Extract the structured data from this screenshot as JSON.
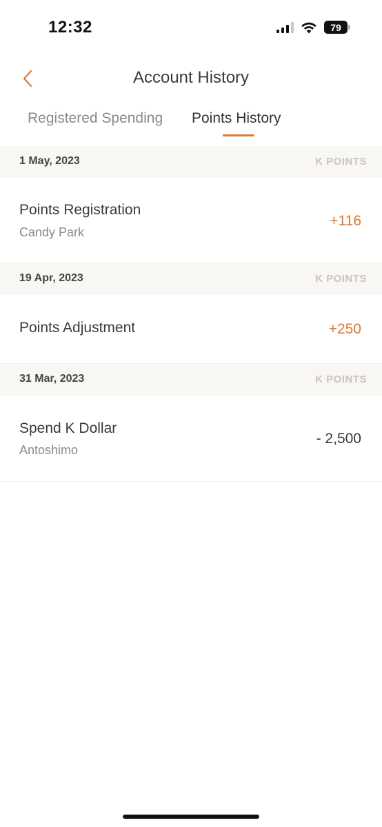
{
  "status_bar": {
    "time": "12:32",
    "battery": "79",
    "icons": [
      "signal-icon",
      "wifi-icon",
      "battery-icon"
    ]
  },
  "header": {
    "title": "Account History",
    "back_icon": "chevron-left-icon"
  },
  "tabs": [
    {
      "label": "Registered Spending",
      "active": false
    },
    {
      "label": "Points History",
      "active": true
    }
  ],
  "colors": {
    "accent": "#e07a2e",
    "section_bg": "#f9f7f3",
    "unit_text": "#c9c5bf"
  },
  "sections": [
    {
      "date": "1 May, 2023",
      "unit": "K POINTS",
      "entries": [
        {
          "title": "Points Registration",
          "subtitle": "Candy Park",
          "amount": "+116",
          "positive": true
        }
      ]
    },
    {
      "date": "19 Apr, 2023",
      "unit": "K POINTS",
      "entries": [
        {
          "title": "Points Adjustment",
          "subtitle": "",
          "amount": "+250",
          "positive": true
        }
      ]
    },
    {
      "date": "31 Mar, 2023",
      "unit": "K POINTS",
      "entries": [
        {
          "title": "Spend K Dollar",
          "subtitle": "Antoshimo",
          "amount": "- 2,500",
          "positive": false
        }
      ]
    }
  ]
}
